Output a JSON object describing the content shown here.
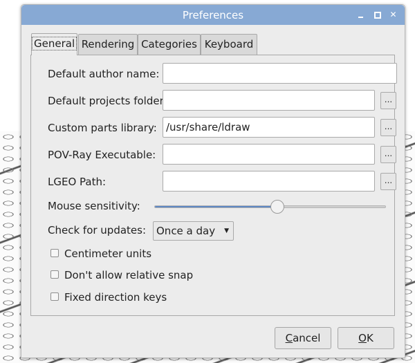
{
  "window": {
    "title": "Preferences"
  },
  "tabs": [
    {
      "label": "General",
      "active": true
    },
    {
      "label": "Rendering",
      "active": false
    },
    {
      "label": "Categories",
      "active": false
    },
    {
      "label": "Keyboard",
      "active": false
    }
  ],
  "general": {
    "author_label": "Default author name:",
    "author_value": "",
    "projects_label": "Default projects folder:",
    "projects_value": "",
    "library_label": "Custom parts library:",
    "library_value": "/usr/share/ldraw",
    "povray_label": "POV-Ray Executable:",
    "povray_value": "",
    "lgeo_label": "LGEO Path:",
    "lgeo_value": "",
    "browse_label": "...",
    "mouse_label": "Mouse sensitivity:",
    "mouse_value_fraction": 0.53,
    "updates_label": "Check for updates:",
    "updates_value": "Once a day",
    "checkboxes": [
      {
        "label": "Centimeter units",
        "checked": false
      },
      {
        "label": "Don't allow relative snap",
        "checked": false
      },
      {
        "label": "Fixed direction keys",
        "checked": false
      }
    ]
  },
  "buttons": {
    "cancel_prefix": "",
    "cancel_mnemonic": "C",
    "cancel_rest": "ancel",
    "ok_mnemonic": "O",
    "ok_rest": "K"
  },
  "colors": {
    "titlebar": "#87a9d4",
    "slider_fill": "#5e87c3"
  }
}
